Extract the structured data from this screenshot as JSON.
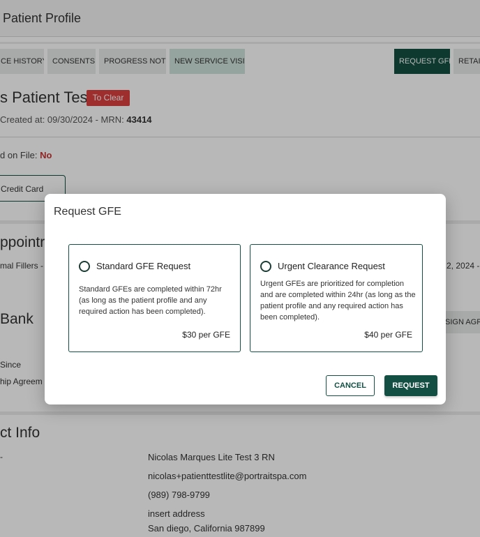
{
  "header": {
    "title": "Patient Profile"
  },
  "tabs": [
    {
      "label": "CE HISTORY"
    },
    {
      "label": "CONSENTS"
    },
    {
      "label": "PROGRESS NOTE"
    },
    {
      "label": "NEW SERVICE VISIT"
    },
    {
      "label": "REQUEST GFE"
    },
    {
      "label": "RETAIL"
    }
  ],
  "patient": {
    "name": "s Patient Test",
    "status_badge": "To Clear",
    "created_prefix": "Created at: 09/30/2024 - MRN: ",
    "mrn": "43414",
    "card_on_file_label": "d on File: ",
    "card_on_file_value": "No",
    "credit_card_button": "Credit Card"
  },
  "sections": {
    "appointments_title": "ppointr",
    "appointment_item": "mal Fillers -",
    "appointment_date": "2, 2024 -",
    "bank_title": "Bank",
    "bank_since": "Since",
    "bank_agreement": "hip Agreem",
    "sign_button": "SIGN AGR",
    "contact_title": "ct Info",
    "contact_dash": "-"
  },
  "contact": {
    "name": "Nicolas Marques Lite Test 3 RN",
    "email": "nicolas+patienttestlite@portraitspa.com",
    "phone": "(989) 798-9799",
    "address_line1": "insert address",
    "address_line2": "San diego, California 987899"
  },
  "colors": {
    "brand": "#134f42",
    "badge_red": "#dc3f3f",
    "overlay": "rgba(0,0,0,0.28)"
  },
  "modal": {
    "title": "Request GFE",
    "options": [
      {
        "title": "Standard GFE Request",
        "description": "Standard GFEs are completed within 72hr (as long as the patient profile and any required action has been completed).",
        "price": "$30 per GFE",
        "selected": false
      },
      {
        "title": "Urgent Clearance Request",
        "description": "Urgent GFEs are prioritized for completion and are completed within 24hr (as long as the patient profile and any required action has been completed).",
        "price": "$40 per GFE",
        "selected": false
      }
    ],
    "cancel_label": "CANCEL",
    "request_label": "REQUEST"
  }
}
